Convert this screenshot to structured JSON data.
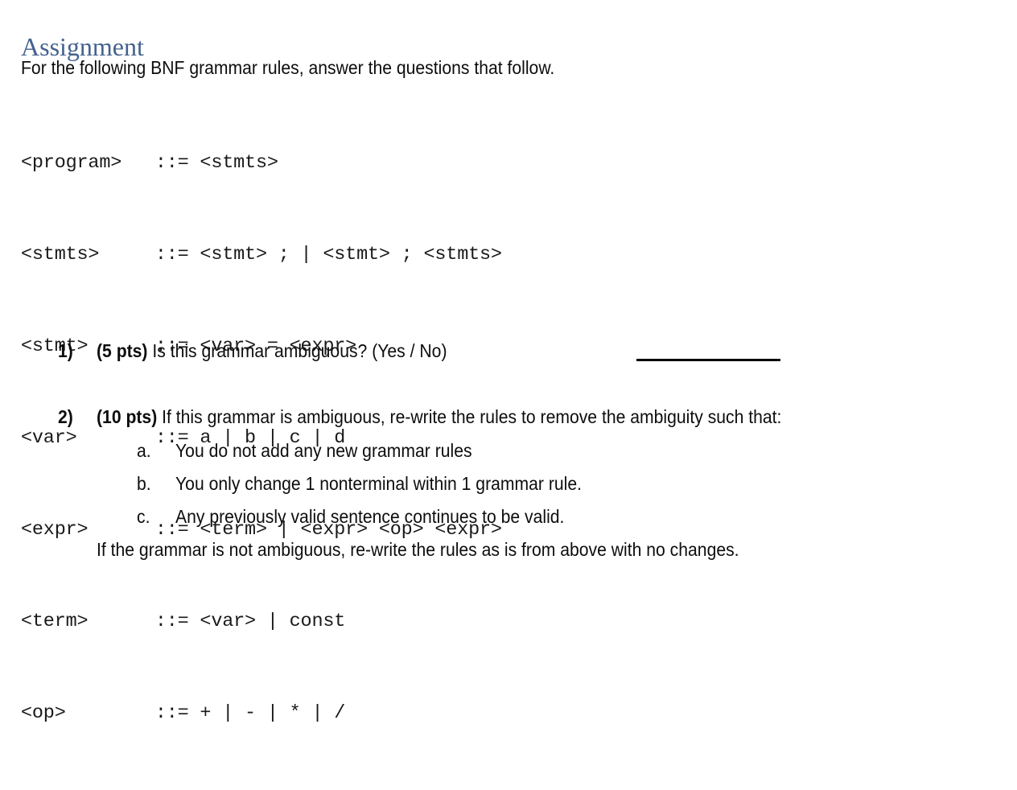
{
  "document": {
    "title": "Assignment",
    "title_color": "#44618E",
    "intro": "For the following BNF grammar rules, answer the questions that follow.",
    "background_color": "#FFFFFF",
    "body_text_color": "#0D0D0D"
  },
  "grammar": {
    "lines": [
      "<program>   ::= <stmts>",
      "<stmts>     ::= <stmt> ; | <stmt> ; <stmts>",
      "<stmt>      ::= <var> = <expr>",
      "<var>       ::= a | b | c | d",
      "<expr>      ::= <term> | <expr> <op> <expr>",
      "<term>      ::= <var> | const",
      "<op>        ::= + | - | * | /"
    ],
    "rules": [
      {
        "lhs": "<program>",
        "op": "::=",
        "rhs": "<stmts>"
      },
      {
        "lhs": "<stmts>",
        "op": "::=",
        "rhs": "<stmt> ; | <stmt> ; <stmts>"
      },
      {
        "lhs": "<stmt>",
        "op": "::=",
        "rhs": "<var> = <expr>"
      },
      {
        "lhs": "<var>",
        "op": "::=",
        "rhs": "a | b | c | d"
      },
      {
        "lhs": "<expr>",
        "op": "::=",
        "rhs": "<term> | <expr> <op> <expr>"
      },
      {
        "lhs": "<term>",
        "op": "::=",
        "rhs": "<var> | const"
      },
      {
        "lhs": "<op>",
        "op": "::=",
        "rhs": "+ | - | * | /"
      }
    ]
  },
  "questions": [
    {
      "marker": "1)",
      "points": "(5 pts)",
      "text": " Is this grammar ambiguous?  (Yes / No)",
      "has_answer_blank": true
    },
    {
      "marker": "2)",
      "points": "(10 pts)",
      "text": " If this grammar is ambiguous, re-write the rules to remove the ambiguity such that:",
      "has_answer_blank": false
    }
  ],
  "subitems": [
    {
      "marker": "a.",
      "text": "You do not add any new grammar rules"
    },
    {
      "marker": "b.",
      "text": "You only change 1 nonterminal within 1 grammar rule."
    },
    {
      "marker": "c.",
      "text": "Any previously valid sentence continues to be valid."
    }
  ],
  "closing": "If the grammar is not ambiguous, re-write the rules as is from above with no changes."
}
